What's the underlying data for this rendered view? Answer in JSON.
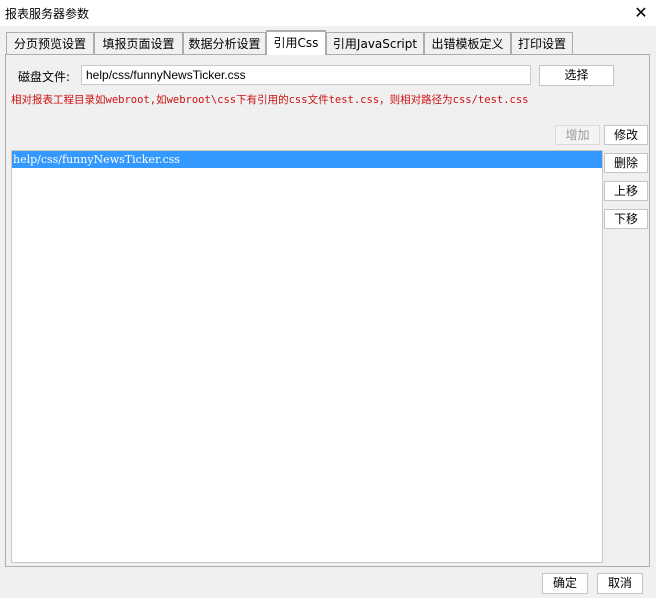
{
  "window": {
    "title": "报表服务器参数",
    "close_icon": "✕"
  },
  "tabs": [
    {
      "label": "分页预览设置",
      "active": false
    },
    {
      "label": "填报页面设置",
      "active": false
    },
    {
      "label": "数据分析设置",
      "active": false
    },
    {
      "label": "引用Css",
      "active": true
    },
    {
      "label": "引用JavaScript",
      "active": false
    },
    {
      "label": "出错模板定义",
      "active": false
    },
    {
      "label": "打印设置",
      "active": false
    }
  ],
  "css_panel": {
    "disk_file_label": "磁盘文件:",
    "disk_file_value": "help/css/funnyNewsTicker.css",
    "select_button": "选择",
    "hint": "相对报表工程目录如webroot,如webroot\\css下有引用的css文件test.css，则相对路径为css/test.css",
    "add_button": "增加",
    "modify_button": "修改",
    "delete_button": "删除",
    "move_up_button": "上移",
    "move_down_button": "下移",
    "list_items": [
      "help/css/funnyNewsTicker.css"
    ]
  },
  "footer": {
    "ok_button": "确定",
    "cancel_button": "取消"
  }
}
